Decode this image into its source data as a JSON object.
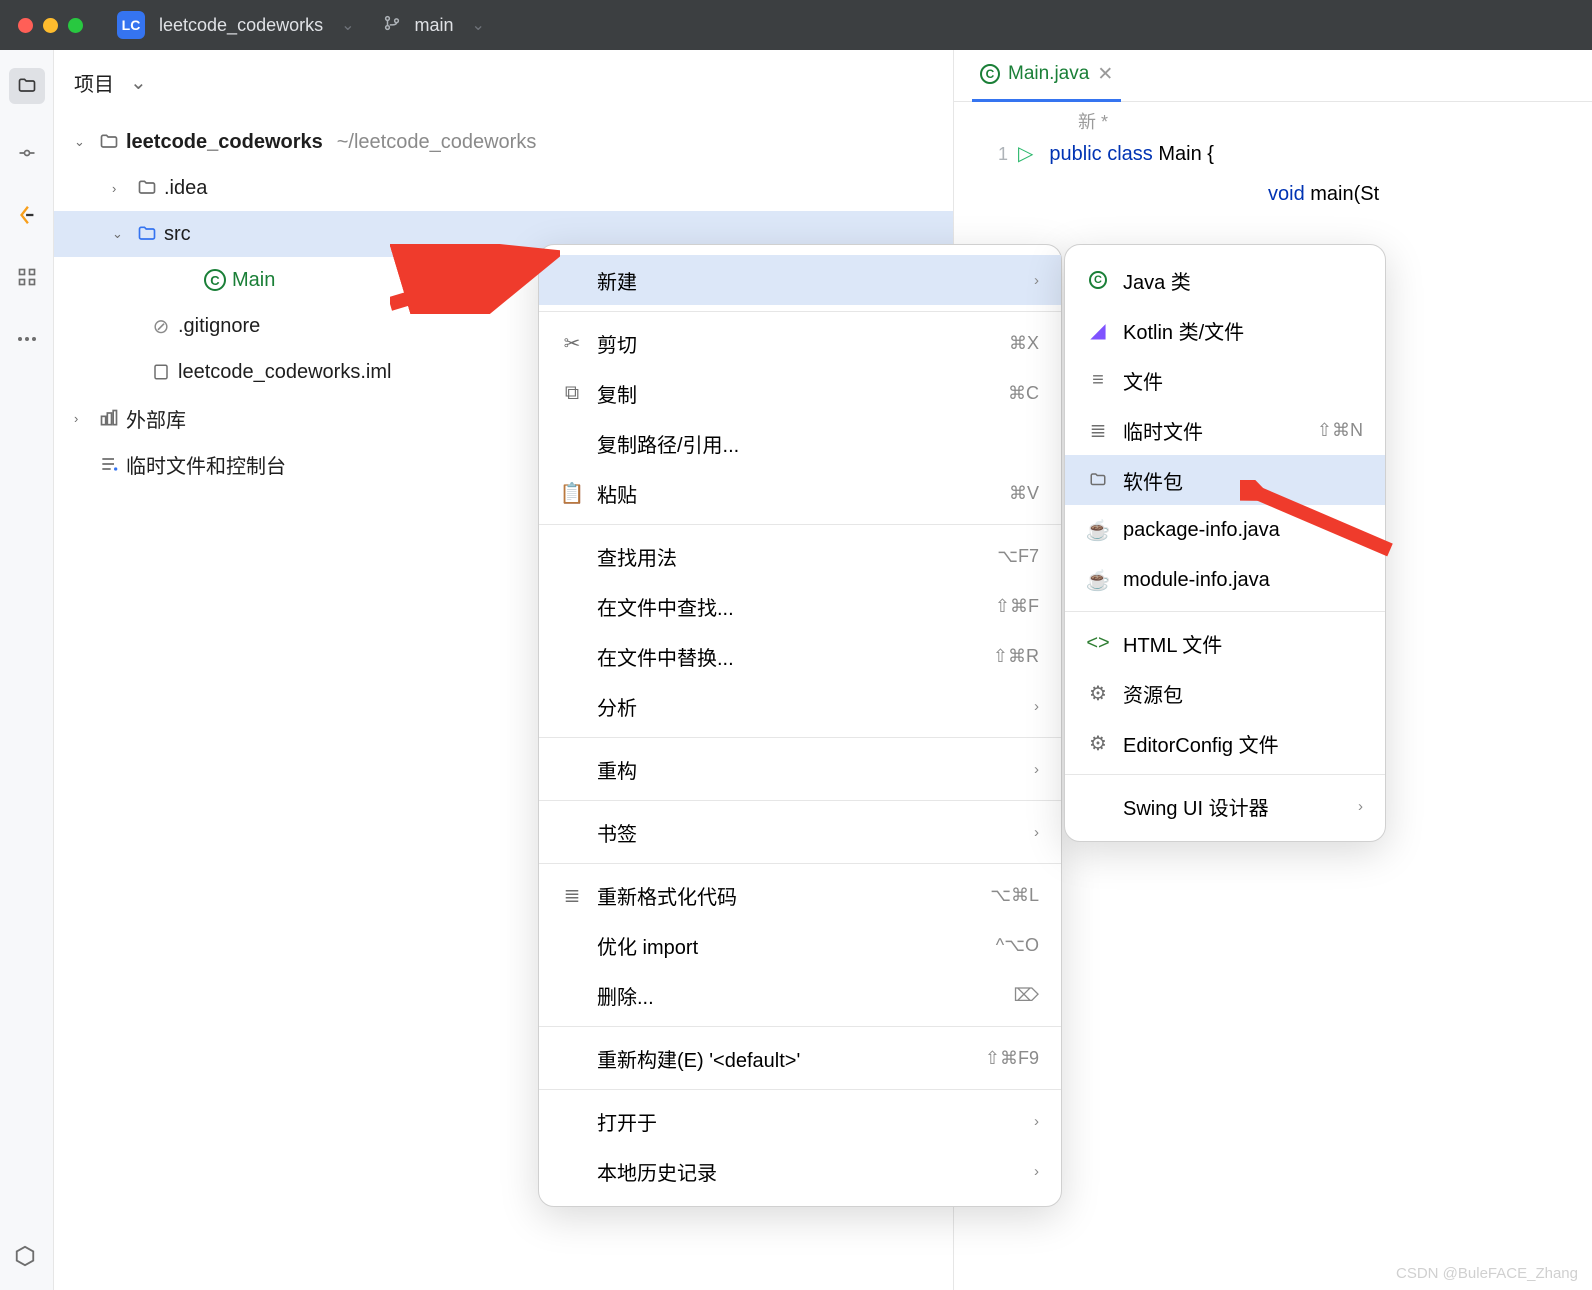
{
  "titlebar": {
    "badge": "LC",
    "project": "leetcode_codeworks",
    "branch": "main"
  },
  "projectPane": {
    "header": "项目",
    "root": {
      "name": "leetcode_codeworks",
      "path": "~/leetcode_codeworks"
    },
    "idea": ".idea",
    "src": "src",
    "main": "Main",
    "gitignore": ".gitignore",
    "iml": "leetcode_codeworks.iml",
    "external": "外部库",
    "scratches": "临时文件和控制台"
  },
  "editor": {
    "tab": "Main.java",
    "banner": "新 *",
    "lineNo": "1",
    "code": {
      "kw1": "public",
      "kw2": "class",
      "name": "Main",
      "brace": "{",
      "kw3": "void",
      "fn": "main",
      "paren": "(St"
    }
  },
  "contextMenu": {
    "new": "新建",
    "cut": {
      "label": "剪切",
      "sc": "⌘X"
    },
    "copy": {
      "label": "复制",
      "sc": "⌘C"
    },
    "copyPath": "复制路径/引用...",
    "paste": {
      "label": "粘贴",
      "sc": "⌘V"
    },
    "findUsages": {
      "label": "查找用法",
      "sc": "⌥F7"
    },
    "findInFiles": {
      "label": "在文件中查找...",
      "sc": "⇧⌘F"
    },
    "replaceInFiles": {
      "label": "在文件中替换...",
      "sc": "⇧⌘R"
    },
    "analyze": "分析",
    "refactor": "重构",
    "bookmarks": "书签",
    "reformat": {
      "label": "重新格式化代码",
      "sc": "⌥⌘L"
    },
    "optimize": {
      "label": "优化 import",
      "sc": "^⌥O"
    },
    "delete": {
      "label": "删除...",
      "sc": "⌦"
    },
    "rebuild": {
      "label": "重新构建(E) '<default>'",
      "sc": "⇧⌘F9"
    },
    "openIn": "打开于",
    "localHistory": "本地历史记录"
  },
  "subMenu": {
    "javaClass": "Java 类",
    "kotlin": "Kotlin 类/文件",
    "file": "文件",
    "scratch": {
      "label": "临时文件",
      "sc": "⇧⌘N"
    },
    "package": "软件包",
    "packageInfo": "package-info.java",
    "moduleInfo": "module-info.java",
    "html": "HTML 文件",
    "resource": "资源包",
    "editorconfig": "EditorConfig 文件",
    "swing": "Swing UI 设计器"
  },
  "watermark": "CSDN @BuleFACE_Zhang"
}
